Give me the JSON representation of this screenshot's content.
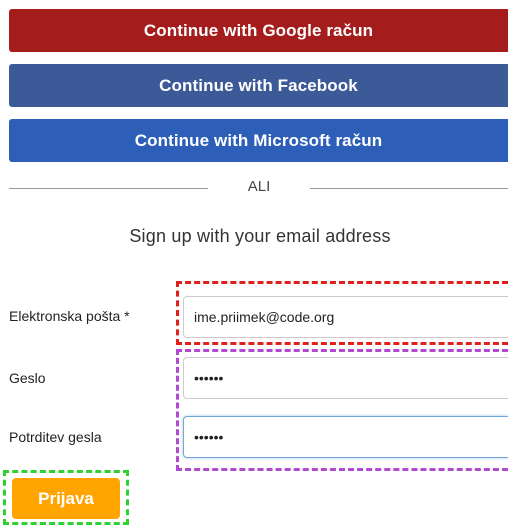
{
  "social": {
    "google_label": "Continue with Google račun",
    "facebook_label": "Continue with Facebook",
    "microsoft_label": "Continue with Microsoft račun"
  },
  "divider": {
    "text": "ALI"
  },
  "signup": {
    "heading": "Sign up with your email address"
  },
  "form": {
    "email": {
      "label": "Elektronska pošta *",
      "value": "ime.priimek@code.org"
    },
    "password": {
      "label": "Geslo",
      "value": "••••••"
    },
    "confirm": {
      "label": "Potrditev gesla",
      "value": "••••••"
    },
    "submit_label": "Prijava"
  },
  "colors": {
    "google": "#a51c1c",
    "facebook": "#3d5a98",
    "microsoft": "#2e5fb8",
    "submit": "#ffa400",
    "highlight_red": "#e0201a",
    "highlight_purple": "#b14ad0",
    "highlight_green": "#2fd12f"
  }
}
